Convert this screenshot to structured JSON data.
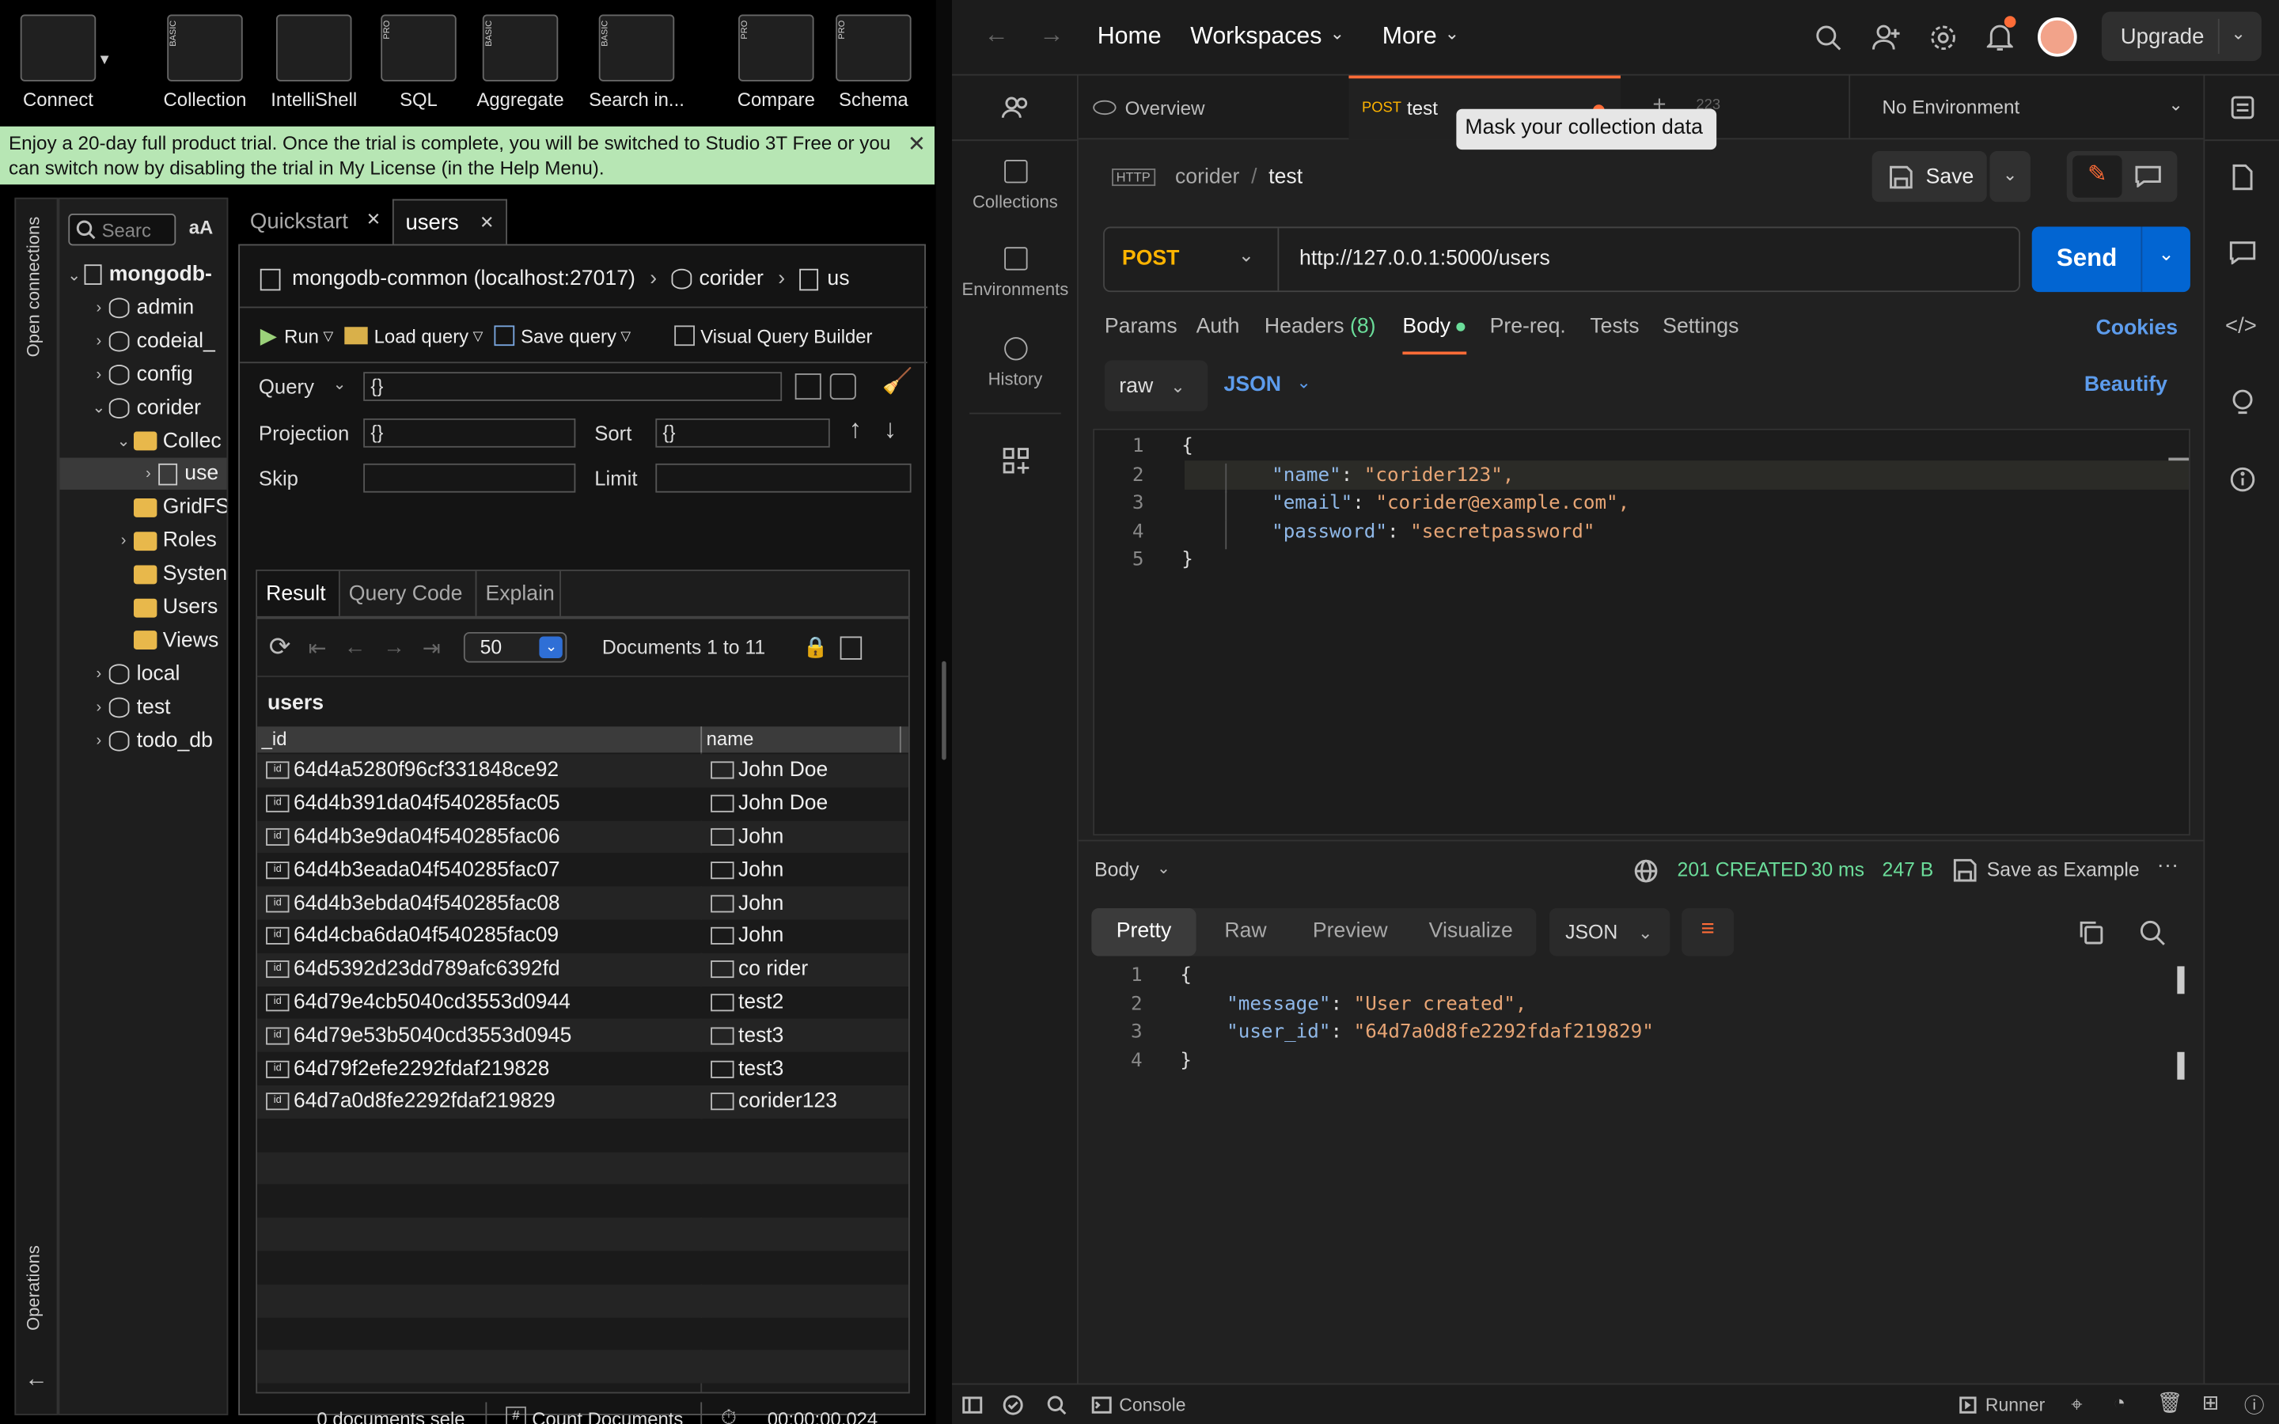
{
  "studio3t": {
    "toolbar": [
      {
        "label": "Connect",
        "tag": ""
      },
      {
        "label": "Collection",
        "tag": "BASIC"
      },
      {
        "label": "IntelliShell",
        "tag": ""
      },
      {
        "label": "SQL",
        "tag": "PRO"
      },
      {
        "label": "Aggregate",
        "tag": "BASIC"
      },
      {
        "label": "Search in...",
        "tag": "BASIC"
      },
      {
        "label": "Compare",
        "tag": "PRO"
      },
      {
        "label": "Schema",
        "tag": "PRO"
      }
    ],
    "trial_banner": "Enjoy a 20-day full product trial. Once the trial is complete, you will be switched to Studio 3T Free or you can switch now by disabling the trial in My License (in the Help Menu).",
    "side_labels": {
      "top": "Open connections",
      "bottom": "Operations"
    },
    "search_placeholder": "Searc",
    "case_toggle": "aA",
    "tree": [
      {
        "label": "mongodb-",
        "level": 0,
        "kind": "server",
        "chev": "down",
        "bold": true
      },
      {
        "label": "admin",
        "level": 1,
        "kind": "db",
        "chev": "right"
      },
      {
        "label": "codeial_",
        "level": 1,
        "kind": "db",
        "chev": "right"
      },
      {
        "label": "config",
        "level": 1,
        "kind": "db",
        "chev": "right"
      },
      {
        "label": "corider",
        "level": 1,
        "kind": "db",
        "chev": "down"
      },
      {
        "label": "Collec",
        "level": 2,
        "kind": "folder",
        "chev": "down"
      },
      {
        "label": "use",
        "level": 3,
        "kind": "coll",
        "chev": "right",
        "selected": true
      },
      {
        "label": "GridFS",
        "level": 2,
        "kind": "folder",
        "chev": ""
      },
      {
        "label": "Roles",
        "level": 2,
        "kind": "folder",
        "chev": "right"
      },
      {
        "label": "Systen",
        "level": 2,
        "kind": "folder",
        "chev": ""
      },
      {
        "label": "Users",
        "level": 2,
        "kind": "folder",
        "chev": ""
      },
      {
        "label": "Views",
        "level": 2,
        "kind": "folder",
        "chev": ""
      },
      {
        "label": "local",
        "level": 1,
        "kind": "db",
        "chev": "right"
      },
      {
        "label": "test",
        "level": 1,
        "kind": "db",
        "chev": "right"
      },
      {
        "label": "todo_db",
        "level": 1,
        "kind": "db",
        "chev": "right"
      }
    ],
    "tabs": [
      {
        "label": "Quickstart",
        "active": false
      },
      {
        "label": "users",
        "active": true
      }
    ],
    "breadcrumb": [
      "mongodb-common (localhost:27017)",
      "corider",
      "us"
    ],
    "query_toolbar": {
      "run": "Run",
      "load": "Load query",
      "save": "Save query",
      "vqb": "Visual Query Builder"
    },
    "query": {
      "mode": "Query",
      "value": "{}",
      "projection_label": "Projection",
      "projection": "{}",
      "sort_label": "Sort",
      "sort": "{}",
      "skip_label": "Skip",
      "limit_label": "Limit"
    },
    "result_tabs": [
      "Result",
      "Query Code",
      "Explain"
    ],
    "page_size": "50",
    "doc_range": "Documents 1 to 11",
    "collection_name": "users",
    "columns": [
      "_id",
      "name"
    ],
    "rows": [
      [
        "64d4a5280f96cf331848ce92",
        "John Doe"
      ],
      [
        "64d4b391da04f540285fac05",
        "John Doe"
      ],
      [
        "64d4b3e9da04f540285fac06",
        "John"
      ],
      [
        "64d4b3eada04f540285fac07",
        "John"
      ],
      [
        "64d4b3ebda04f540285fac08",
        "John"
      ],
      [
        "64d4cba6da04f540285fac09",
        "John"
      ],
      [
        "64d5392d23dd789afc6392fd",
        "co rider"
      ],
      [
        "64d79e4cb5040cd3553d0944",
        "test2"
      ],
      [
        "64d79e53b5040cd3553d0945",
        "test3"
      ],
      [
        "64d79f2efe2292fdaf219828",
        "test3"
      ],
      [
        "64d7a0d8fe2292fdaf219829",
        "corider123"
      ]
    ],
    "footer": {
      "selected": "0 documents sele",
      "count": "Count Documents",
      "time": "00:00:00.024"
    }
  },
  "postman": {
    "nav": [
      "Home",
      "Workspaces",
      "More"
    ],
    "upgrade": "Upgrade",
    "sidebar": [
      "Collections",
      "Environments",
      "History"
    ],
    "tabs": [
      {
        "method": "",
        "label": "Overview"
      },
      {
        "method": "POST",
        "label": "test"
      }
    ],
    "tab_partial": "223",
    "tooltip": "Mask your collection data",
    "environment": "No Environment",
    "breadcrumb": {
      "collection": "corider",
      "sep": "/",
      "request": "test"
    },
    "save": "Save",
    "method": "POST",
    "url": "http://127.0.0.1:5000/users",
    "send": "Send",
    "req_tabs": [
      {
        "label": "Params",
        "active": false
      },
      {
        "label": "Auth",
        "active": false
      },
      {
        "label": "Headers",
        "count": "(8)",
        "active": false
      },
      {
        "label": "Body",
        "active": true
      },
      {
        "label": "Pre-req.",
        "active": false
      },
      {
        "label": "Tests",
        "active": false
      },
      {
        "label": "Settings",
        "active": false
      }
    ],
    "cookies": "Cookies",
    "body_mode": "raw",
    "body_lang": "JSON",
    "beautify": "Beautify",
    "request_body": [
      {
        "n": "1",
        "text": "{"
      },
      {
        "n": "2",
        "key": "\"name\"",
        "val": "\"corider123\","
      },
      {
        "n": "3",
        "key": "\"email\"",
        "val": "\"corider@example.com\","
      },
      {
        "n": "4",
        "key": "\"password\"",
        "val": "\"secretpassword\""
      },
      {
        "n": "5",
        "text": "}"
      }
    ],
    "response": {
      "label": "Body",
      "status": "201 CREATED",
      "time": "30 ms",
      "size": "247 B",
      "save_example": "Save as Example",
      "tabs": [
        "Pretty",
        "Raw",
        "Preview",
        "Visualize"
      ],
      "format": "JSON",
      "body": [
        {
          "n": "1",
          "text": "{"
        },
        {
          "n": "2",
          "key": "\"message\"",
          "val": "\"User created\","
        },
        {
          "n": "3",
          "key": "\"user_id\"",
          "val": "\"64d7a0d8fe2292fdaf219829\""
        },
        {
          "n": "4",
          "text": "}"
        }
      ]
    },
    "status_bar": {
      "console": "Console",
      "runner": "Runner"
    },
    "colors": {
      "accent": "#ff6c37",
      "send": "#0265d2",
      "post": "#ffb400",
      "status_ok": "#6bdd9a"
    }
  }
}
